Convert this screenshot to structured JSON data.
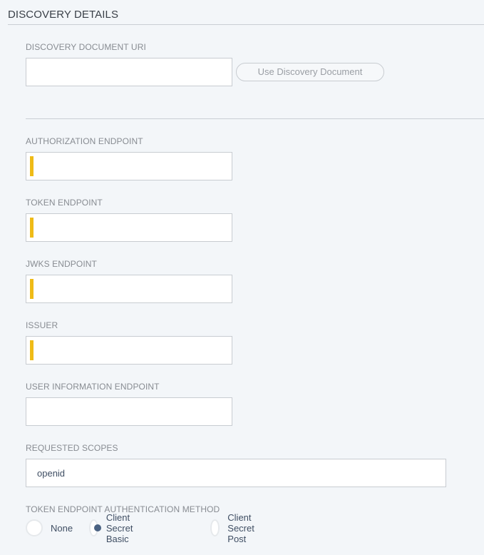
{
  "section": {
    "title": "DISCOVERY DETAILS"
  },
  "discovery": {
    "label": "DISCOVERY DOCUMENT URI",
    "value": "",
    "button_label": "Use Discovery Document"
  },
  "fields": {
    "authorization": {
      "label": "AUTHORIZATION ENDPOINT",
      "value": "",
      "required": true
    },
    "token": {
      "label": "TOKEN ENDPOINT",
      "value": "",
      "required": true
    },
    "jwks": {
      "label": "JWKS ENDPOINT",
      "value": "",
      "required": true
    },
    "issuer": {
      "label": "ISSUER",
      "value": "",
      "required": true
    },
    "userinfo": {
      "label": "USER INFORMATION ENDPOINT",
      "value": "",
      "required": false
    },
    "scopes": {
      "label": "REQUESTED SCOPES",
      "value": "openid"
    }
  },
  "auth_method": {
    "label": "TOKEN ENDPOINT AUTHENTICATION METHOD",
    "options": [
      {
        "label": "None",
        "selected": false
      },
      {
        "label": "Client Secret Basic",
        "selected": true
      },
      {
        "label": "Client Secret Post",
        "selected": false
      }
    ]
  },
  "colors": {
    "required_indicator": "#efbb17",
    "radio_selected": "#4a6282"
  }
}
